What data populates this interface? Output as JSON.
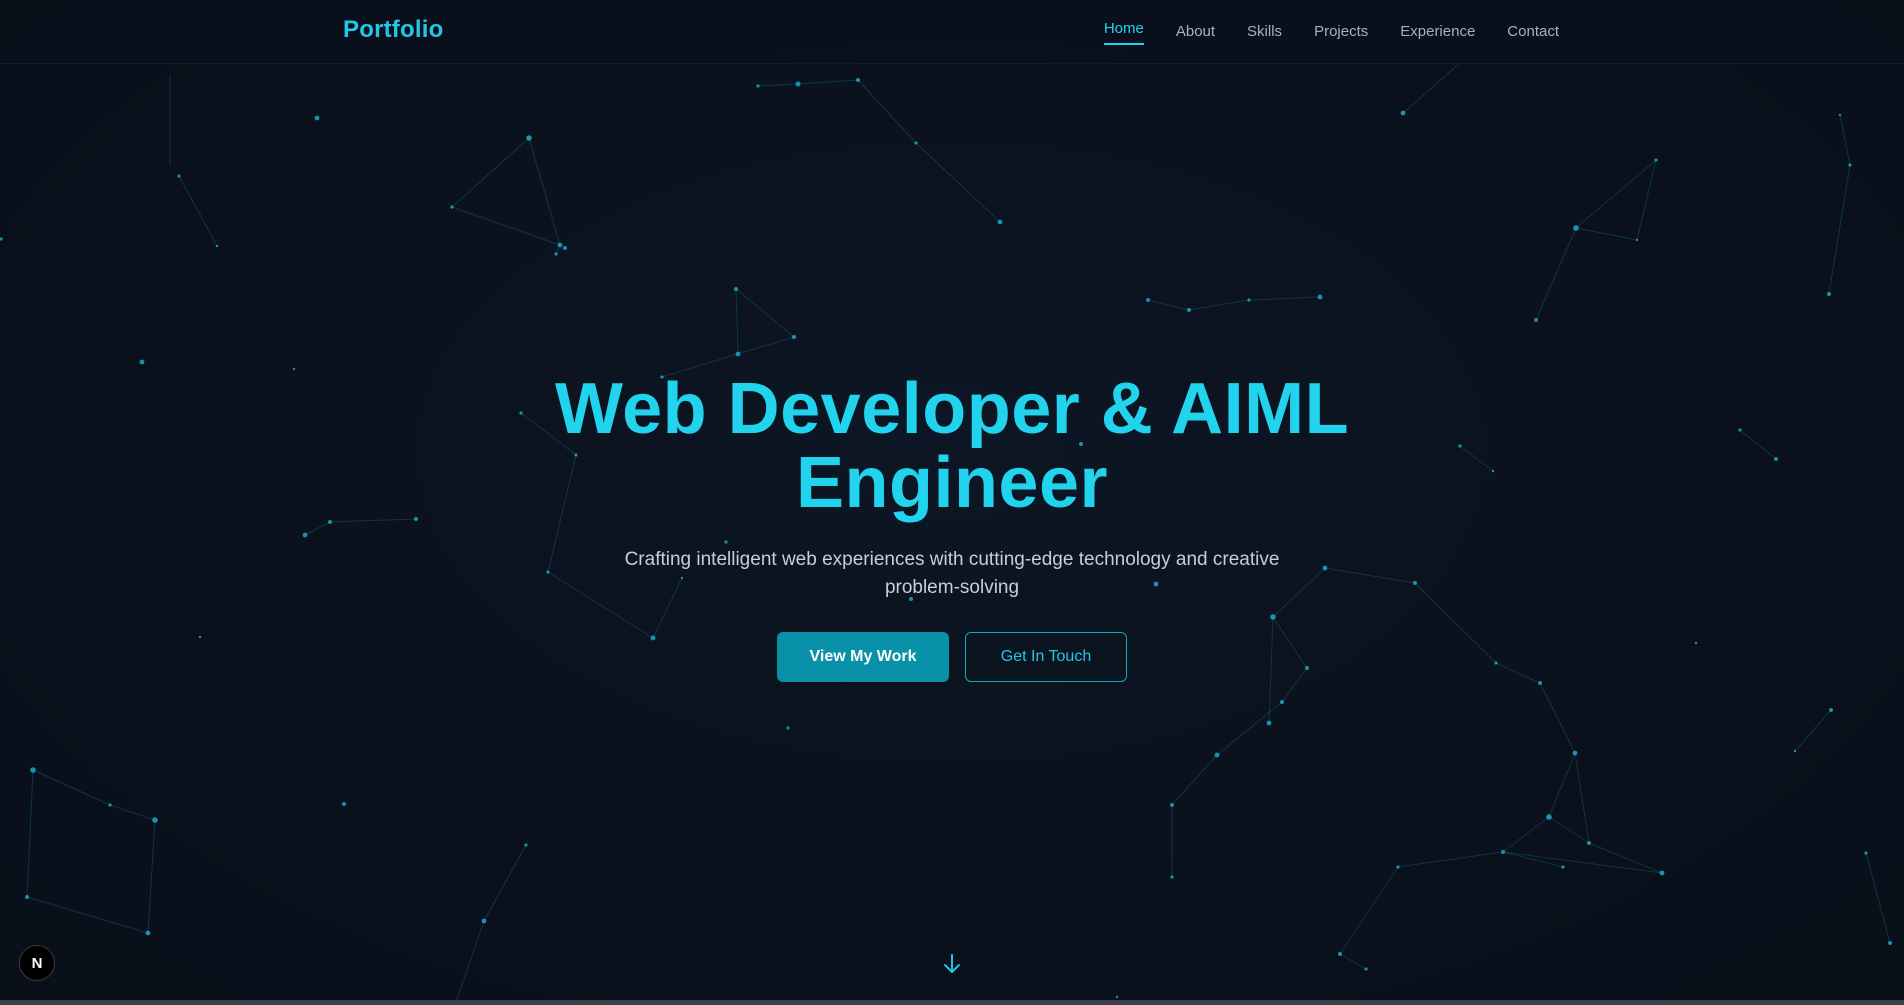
{
  "nav": {
    "logo": "Portfolio",
    "links": [
      "Home",
      "About",
      "Skills",
      "Projects",
      "Experience",
      "Contact"
    ],
    "active": "Home"
  },
  "hero": {
    "title": "Web Developer & AIML Engineer",
    "subtitle": "Crafting intelligent web experiences with cutting-edge technology and creative problem-solving",
    "primary_button": "View My Work",
    "secondary_button": "Get In Touch"
  },
  "icons": {
    "scroll_down": "arrow-down-icon",
    "dev_badge": "nextjs-badge-icon",
    "dev_badge_letter": "N"
  },
  "colors": {
    "background": "#0a111d",
    "accent": "#22d3ee",
    "primary_button": "#0891a8",
    "text_muted": "#a7b0bd",
    "particles": "#1aa6c4"
  }
}
